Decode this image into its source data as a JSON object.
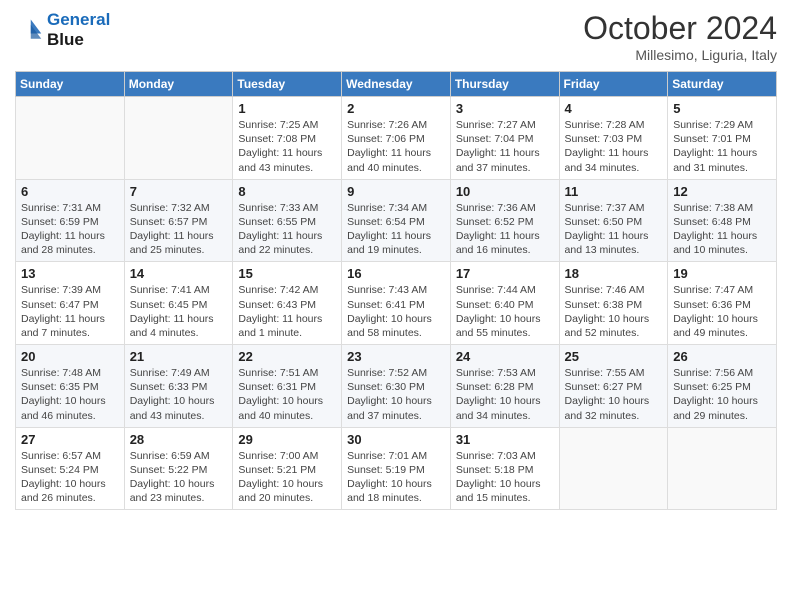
{
  "logo": {
    "line1": "General",
    "line2": "Blue"
  },
  "title": "October 2024",
  "location": "Millesimo, Liguria, Italy",
  "days_of_week": [
    "Sunday",
    "Monday",
    "Tuesday",
    "Wednesday",
    "Thursday",
    "Friday",
    "Saturday"
  ],
  "weeks": [
    [
      {
        "day": "",
        "info": ""
      },
      {
        "day": "",
        "info": ""
      },
      {
        "day": "1",
        "info": "Sunrise: 7:25 AM\nSunset: 7:08 PM\nDaylight: 11 hours and 43 minutes."
      },
      {
        "day": "2",
        "info": "Sunrise: 7:26 AM\nSunset: 7:06 PM\nDaylight: 11 hours and 40 minutes."
      },
      {
        "day": "3",
        "info": "Sunrise: 7:27 AM\nSunset: 7:04 PM\nDaylight: 11 hours and 37 minutes."
      },
      {
        "day": "4",
        "info": "Sunrise: 7:28 AM\nSunset: 7:03 PM\nDaylight: 11 hours and 34 minutes."
      },
      {
        "day": "5",
        "info": "Sunrise: 7:29 AM\nSunset: 7:01 PM\nDaylight: 11 hours and 31 minutes."
      }
    ],
    [
      {
        "day": "6",
        "info": "Sunrise: 7:31 AM\nSunset: 6:59 PM\nDaylight: 11 hours and 28 minutes."
      },
      {
        "day": "7",
        "info": "Sunrise: 7:32 AM\nSunset: 6:57 PM\nDaylight: 11 hours and 25 minutes."
      },
      {
        "day": "8",
        "info": "Sunrise: 7:33 AM\nSunset: 6:55 PM\nDaylight: 11 hours and 22 minutes."
      },
      {
        "day": "9",
        "info": "Sunrise: 7:34 AM\nSunset: 6:54 PM\nDaylight: 11 hours and 19 minutes."
      },
      {
        "day": "10",
        "info": "Sunrise: 7:36 AM\nSunset: 6:52 PM\nDaylight: 11 hours and 16 minutes."
      },
      {
        "day": "11",
        "info": "Sunrise: 7:37 AM\nSunset: 6:50 PM\nDaylight: 11 hours and 13 minutes."
      },
      {
        "day": "12",
        "info": "Sunrise: 7:38 AM\nSunset: 6:48 PM\nDaylight: 11 hours and 10 minutes."
      }
    ],
    [
      {
        "day": "13",
        "info": "Sunrise: 7:39 AM\nSunset: 6:47 PM\nDaylight: 11 hours and 7 minutes."
      },
      {
        "day": "14",
        "info": "Sunrise: 7:41 AM\nSunset: 6:45 PM\nDaylight: 11 hours and 4 minutes."
      },
      {
        "day": "15",
        "info": "Sunrise: 7:42 AM\nSunset: 6:43 PM\nDaylight: 11 hours and 1 minute."
      },
      {
        "day": "16",
        "info": "Sunrise: 7:43 AM\nSunset: 6:41 PM\nDaylight: 10 hours and 58 minutes."
      },
      {
        "day": "17",
        "info": "Sunrise: 7:44 AM\nSunset: 6:40 PM\nDaylight: 10 hours and 55 minutes."
      },
      {
        "day": "18",
        "info": "Sunrise: 7:46 AM\nSunset: 6:38 PM\nDaylight: 10 hours and 52 minutes."
      },
      {
        "day": "19",
        "info": "Sunrise: 7:47 AM\nSunset: 6:36 PM\nDaylight: 10 hours and 49 minutes."
      }
    ],
    [
      {
        "day": "20",
        "info": "Sunrise: 7:48 AM\nSunset: 6:35 PM\nDaylight: 10 hours and 46 minutes."
      },
      {
        "day": "21",
        "info": "Sunrise: 7:49 AM\nSunset: 6:33 PM\nDaylight: 10 hours and 43 minutes."
      },
      {
        "day": "22",
        "info": "Sunrise: 7:51 AM\nSunset: 6:31 PM\nDaylight: 10 hours and 40 minutes."
      },
      {
        "day": "23",
        "info": "Sunrise: 7:52 AM\nSunset: 6:30 PM\nDaylight: 10 hours and 37 minutes."
      },
      {
        "day": "24",
        "info": "Sunrise: 7:53 AM\nSunset: 6:28 PM\nDaylight: 10 hours and 34 minutes."
      },
      {
        "day": "25",
        "info": "Sunrise: 7:55 AM\nSunset: 6:27 PM\nDaylight: 10 hours and 32 minutes."
      },
      {
        "day": "26",
        "info": "Sunrise: 7:56 AM\nSunset: 6:25 PM\nDaylight: 10 hours and 29 minutes."
      }
    ],
    [
      {
        "day": "27",
        "info": "Sunrise: 6:57 AM\nSunset: 5:24 PM\nDaylight: 10 hours and 26 minutes."
      },
      {
        "day": "28",
        "info": "Sunrise: 6:59 AM\nSunset: 5:22 PM\nDaylight: 10 hours and 23 minutes."
      },
      {
        "day": "29",
        "info": "Sunrise: 7:00 AM\nSunset: 5:21 PM\nDaylight: 10 hours and 20 minutes."
      },
      {
        "day": "30",
        "info": "Sunrise: 7:01 AM\nSunset: 5:19 PM\nDaylight: 10 hours and 18 minutes."
      },
      {
        "day": "31",
        "info": "Sunrise: 7:03 AM\nSunset: 5:18 PM\nDaylight: 10 hours and 15 minutes."
      },
      {
        "day": "",
        "info": ""
      },
      {
        "day": "",
        "info": ""
      }
    ]
  ]
}
